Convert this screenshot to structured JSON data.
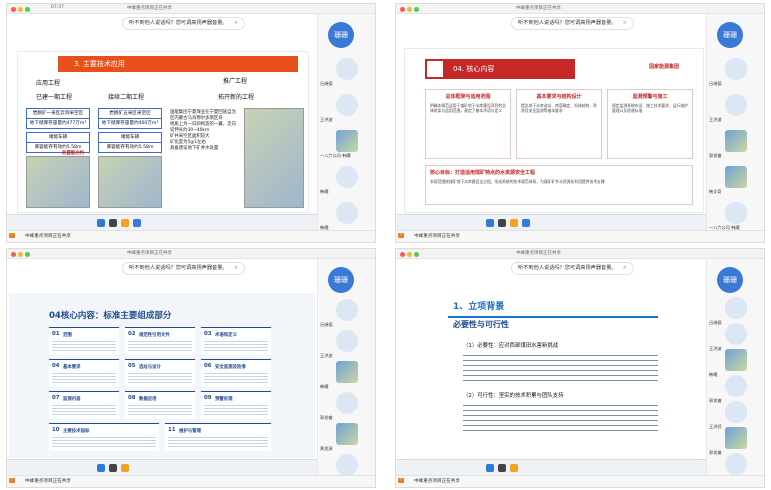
{
  "meeting": {
    "title": "中峰重点项目工作推进会",
    "notice": "听不到他人说话吗？您可调高扬声器音量。",
    "notice_close": "×",
    "share_label": "中峰重点项目正在共享",
    "self_name": "珊珊"
  },
  "quadrants": [
    {
      "time": "07:47",
      "title_short": "中峰重点项目正在共享",
      "slide_title": "3. 主要技术应用",
      "heads": [
        "应用工程",
        "已建一期工程",
        "接续二期工程",
        "推广工程",
        "拓开新的工程"
      ],
      "boxes": [
        "岩脱矿一采区云洞采空区",
        "地下储库存容量约477万m³",
        "储能车辆",
        "库容能存有效约5.58m",
        "岩脱矿五采区采空区",
        "地下储库存容量约400万m³",
        "储能车辆",
        "库容能存有效约5.58m"
      ],
      "notes": [
        "国能集团宁夏煤业在宁夏回族自治区内蒙古乌海鄂尔多斯区块",
        "地质上为一向斜构造的一翼，走向延伸长约30~40km",
        "矿井采空区面积较大",
        "矿化度为5g/L左右",
        "具备建设地下矿井水处置"
      ],
      "red_label": "处置能力约",
      "participants": [
        "吕继德",
        "王洪波",
        "一八六公司 韩曦",
        "韩曦",
        "韩曦"
      ]
    },
    {
      "title_short": "中峰重点项目正在共享",
      "slide_title": "04. 核心内容",
      "logo": "国家能源集团",
      "columns": [
        {
          "head": "总体框架与适用范围",
          "body": "明确本规范适用于煤矿地下水库建设项目的总体框架与适用范围，规定了基本术语与定义"
        },
        {
          "head": "基本要求与结构设计",
          "body": "提出地下水库选址、库容确定、坝体结构、防渗及安全监测等基本要求"
        },
        {
          "head": "监测预警与施工",
          "body": "规定监测系统布设、施工技术要求、运行维护管理以及验收标准"
        }
      ],
      "bottom_head": "核心目标：打造适用煤矿特点的水资源安全工程",
      "bottom_body": "本规范围绕煤矿地下水库建设全过程，形成系统的技术规范体系，为煤矿矿井水资源化利用提供技术支撑",
      "participants": [
        "吕继德",
        "王洪波",
        "郭发睿",
        "韩文奇",
        "一八六公司 韩曦"
      ]
    },
    {
      "title_short": "中峰重点项目正在共享",
      "slide_title": "04核心内容：标准主要组成部分",
      "cards": [
        {
          "n": "01",
          "t": "范围"
        },
        {
          "n": "02",
          "t": "规范性引用文件"
        },
        {
          "n": "03",
          "t": "术语和定义"
        },
        {
          "n": "04",
          "t": "基本要求"
        },
        {
          "n": "05",
          "t": "选址与设计"
        },
        {
          "n": "06",
          "t": "安全监测及防渗"
        },
        {
          "n": "07",
          "t": "监测内容"
        },
        {
          "n": "08",
          "t": "数据应用"
        },
        {
          "n": "09",
          "t": "预警处理"
        },
        {
          "n": "10",
          "t": "主要技术指标"
        },
        {
          "n": "11",
          "t": "维护与管理"
        }
      ],
      "participants": [
        "吕继德",
        "王洪波",
        "韩曦",
        "郭发睿",
        "黄发源",
        "一八六公司 韩曦"
      ]
    },
    {
      "title_short": "中峰重点项目正在共享",
      "slide_num": "1、立项背景",
      "slide_sub": "必要性与可行性",
      "sections": [
        "（1）必要性：应对西部煤田水害新挑战",
        "（2）可行性：坚实的技术积累与团队支持"
      ],
      "participants": [
        "吕继德",
        "王洪波",
        "韩曦",
        "郭发睿",
        "王洪武",
        "郭发睿",
        "一八六公司 韩曦"
      ]
    }
  ],
  "colors": {
    "accent_blue": "#3a79d6",
    "slide_red": "#c62828",
    "slide_orange": "#e8501b",
    "slide_navy": "#1f4a8c"
  }
}
